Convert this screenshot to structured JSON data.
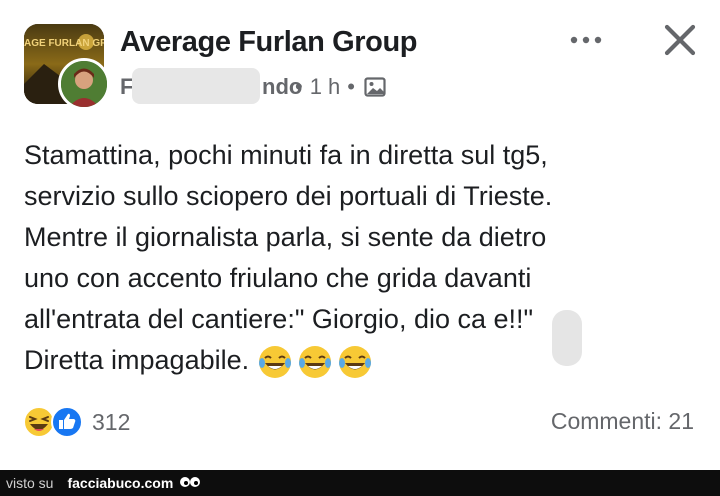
{
  "post": {
    "group_name": "Average Furlan Group",
    "group_avatar_text": "AGE FURLAN GR",
    "author_visible_fragment_start": "F",
    "author_visible_fragment_end": "ndo",
    "separator": "•",
    "time": "1 h",
    "privacy_icon": "gallery-icon",
    "text_lines": [
      "Stamattina, pochi minuti fa in diretta sul tg5,",
      "servizio sullo sciopero dei portuali di Trieste.",
      "Mentre il giornalista parla, si sente da dietro",
      "uno con accento friulano che grida davanti",
      "all'entrata del cantiere:\" Giorgio, dio ca  e!!\"",
      "Diretta impagabile."
    ],
    "trailing_emojis": [
      "tears-of-joy-emoji",
      "tears-of-joy-emoji",
      "tears-of-joy-emoji"
    ]
  },
  "reactions": {
    "icons": [
      "haha-reaction-icon",
      "like-reaction-icon"
    ],
    "count": "312",
    "comments_label": "Commenti: 21"
  },
  "header_actions": {
    "more_icon": "more-dots-icon",
    "close_icon": "close-icon"
  },
  "footer": {
    "visto_su": "visto su",
    "site": "facciabuco.com"
  },
  "colors": {
    "text_primary": "#1c1e21",
    "text_secondary": "#65676b",
    "like_blue": "#1877f2",
    "haha_yellow": "#f7c935",
    "footer_bg": "#0d0d0d"
  }
}
